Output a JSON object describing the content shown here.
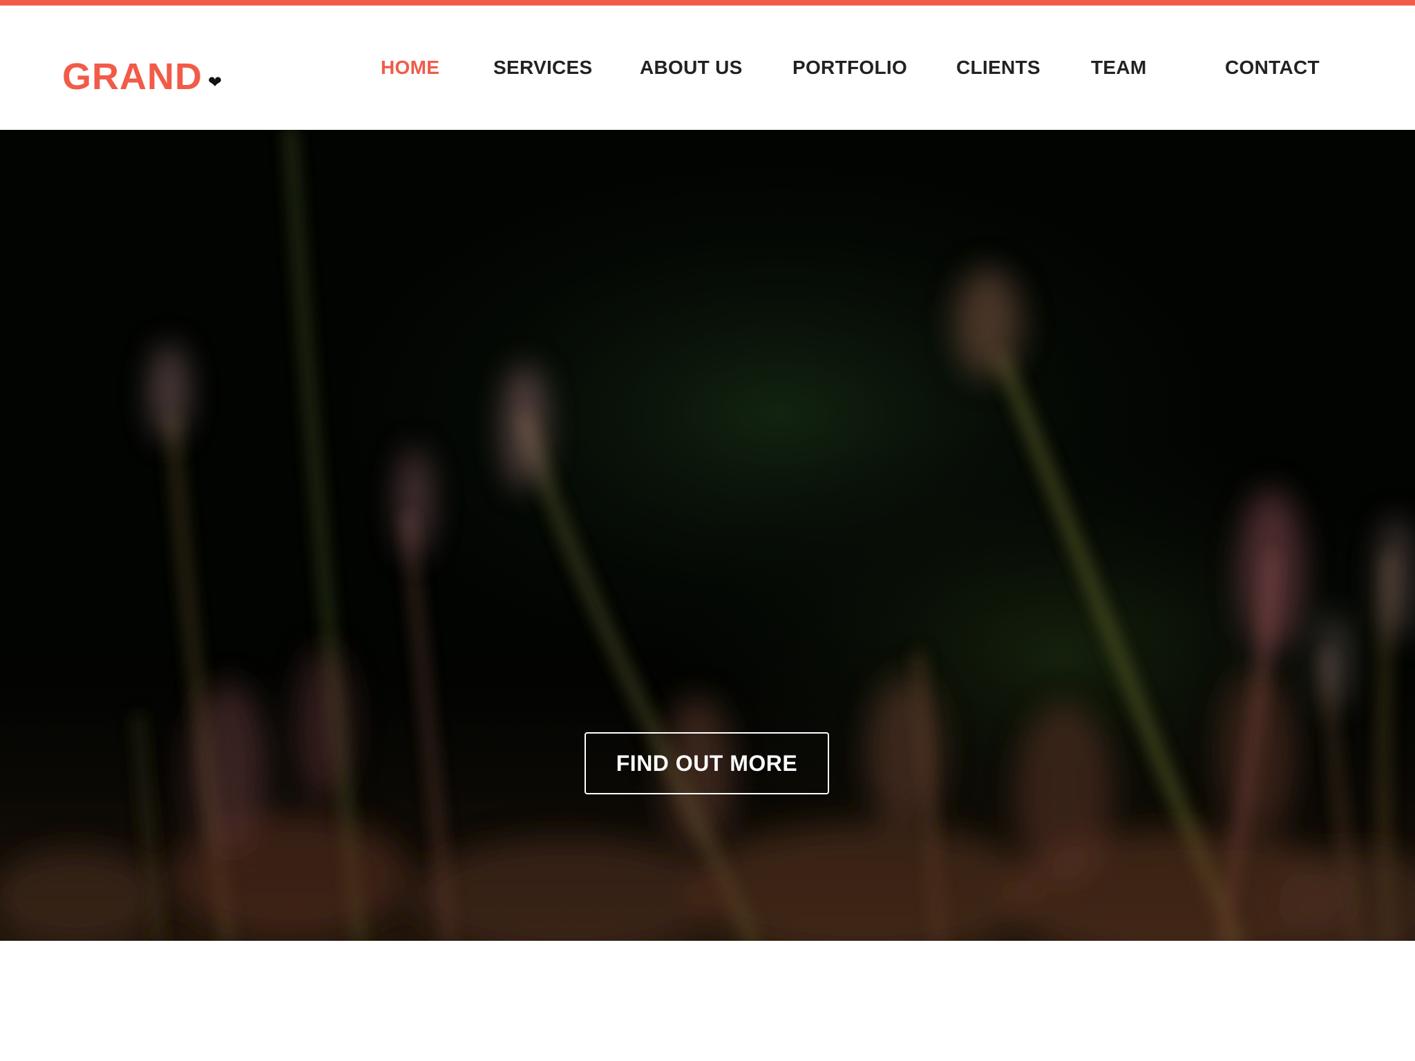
{
  "colors": {
    "accent": "#f15b48",
    "nav_text": "#222222",
    "hero_bg": "#020402",
    "cta_text": "#ffffff"
  },
  "brand": {
    "name": "GRAND",
    "icon": "heart-icon"
  },
  "nav": {
    "items": [
      {
        "label": "HOME",
        "active": true
      },
      {
        "label": "SERVICES",
        "active": false
      },
      {
        "label": "ABOUT US",
        "active": false
      },
      {
        "label": "PORTFOLIO",
        "active": false
      },
      {
        "label": "CLIENTS",
        "active": false
      },
      {
        "label": "TEAM",
        "active": false
      },
      {
        "label": "CONTACT",
        "active": false
      }
    ]
  },
  "hero": {
    "cta_label": "FIND OUT MORE"
  }
}
